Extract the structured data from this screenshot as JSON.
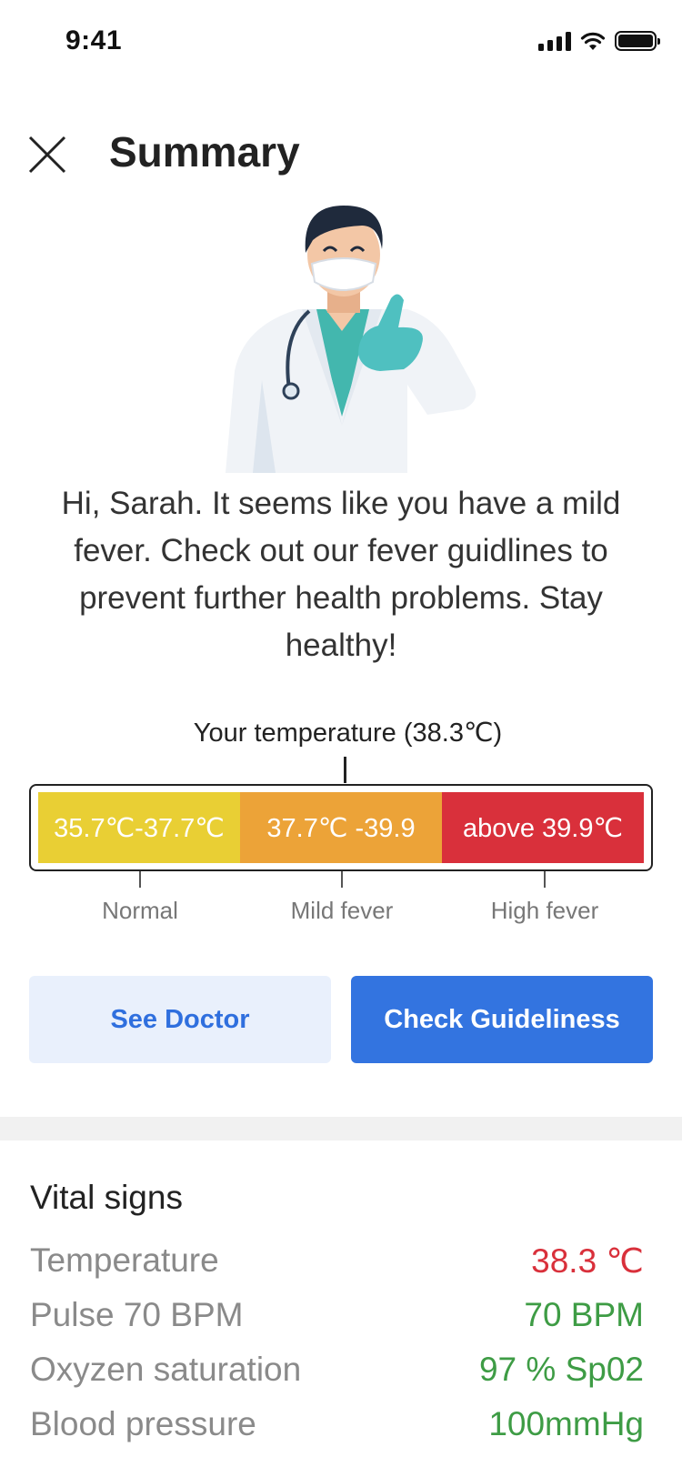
{
  "status_bar": {
    "time": "9:41"
  },
  "header": {
    "title": "Summary"
  },
  "message": "Hi, Sarah. It seems like you have a mild fever.  Check out our fever guidlines to prevent further health problems. Stay healthy!",
  "temperature": {
    "label": "Your temperature (38.3℃)",
    "value_c": 38.3,
    "bands": [
      {
        "range": "35.7℃-37.7℃",
        "name": "Normal",
        "color": "#e9cf34"
      },
      {
        "range": "37.7℃ -39.9",
        "name": "Mild fever",
        "color": "#eca338"
      },
      {
        "range": "above 39.9℃",
        "name": "High fever",
        "color": "#d9303b"
      }
    ]
  },
  "buttons": {
    "see_doctor": "See Doctor",
    "check_guidelines": "Check Guideliness"
  },
  "vitals": {
    "title": "Vital signs",
    "items": [
      {
        "name": "Temperature",
        "value": "38.3 ℃",
        "status_color": "#d9303b"
      },
      {
        "name": "Pulse 70 BPM",
        "value": "70 BPM",
        "status_color": "#3e9c45"
      },
      {
        "name": "Oxyzen saturation",
        "value": "97 % Sp02",
        "status_color": "#3e9c45"
      },
      {
        "name": "Blood pressure",
        "value": "100mmHg",
        "status_color": "#3e9c45"
      }
    ]
  },
  "icons": {
    "close": "close-icon",
    "signal": "cellular-signal-icon",
    "wifi": "wifi-icon",
    "battery": "battery-icon"
  }
}
